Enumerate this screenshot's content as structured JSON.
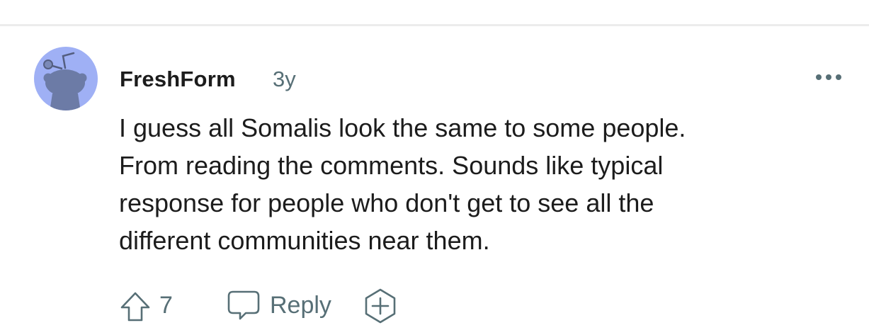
{
  "comment": {
    "author": "FreshForm",
    "age": "3y",
    "body_lines": [
      "I guess all Somalis look the same to some people.",
      "From reading the comments. Sounds like typical",
      "response for people who don't get to see all the",
      "different communities near them."
    ],
    "vote_count": "7",
    "reply_label": "Reply"
  },
  "icons": {
    "avatar": "snoo-avatar",
    "more": "ellipsis-icon",
    "upvote": "upvote-arrow-icon",
    "reply": "speech-bubble-icon",
    "award": "award-plus-icon"
  },
  "colors": {
    "avatar_bg": "#9fb0f5",
    "avatar_figure": "#6c7ba6",
    "muted_text": "#576f76",
    "body_text": "#1c1c1c",
    "divider": "#ececec"
  }
}
